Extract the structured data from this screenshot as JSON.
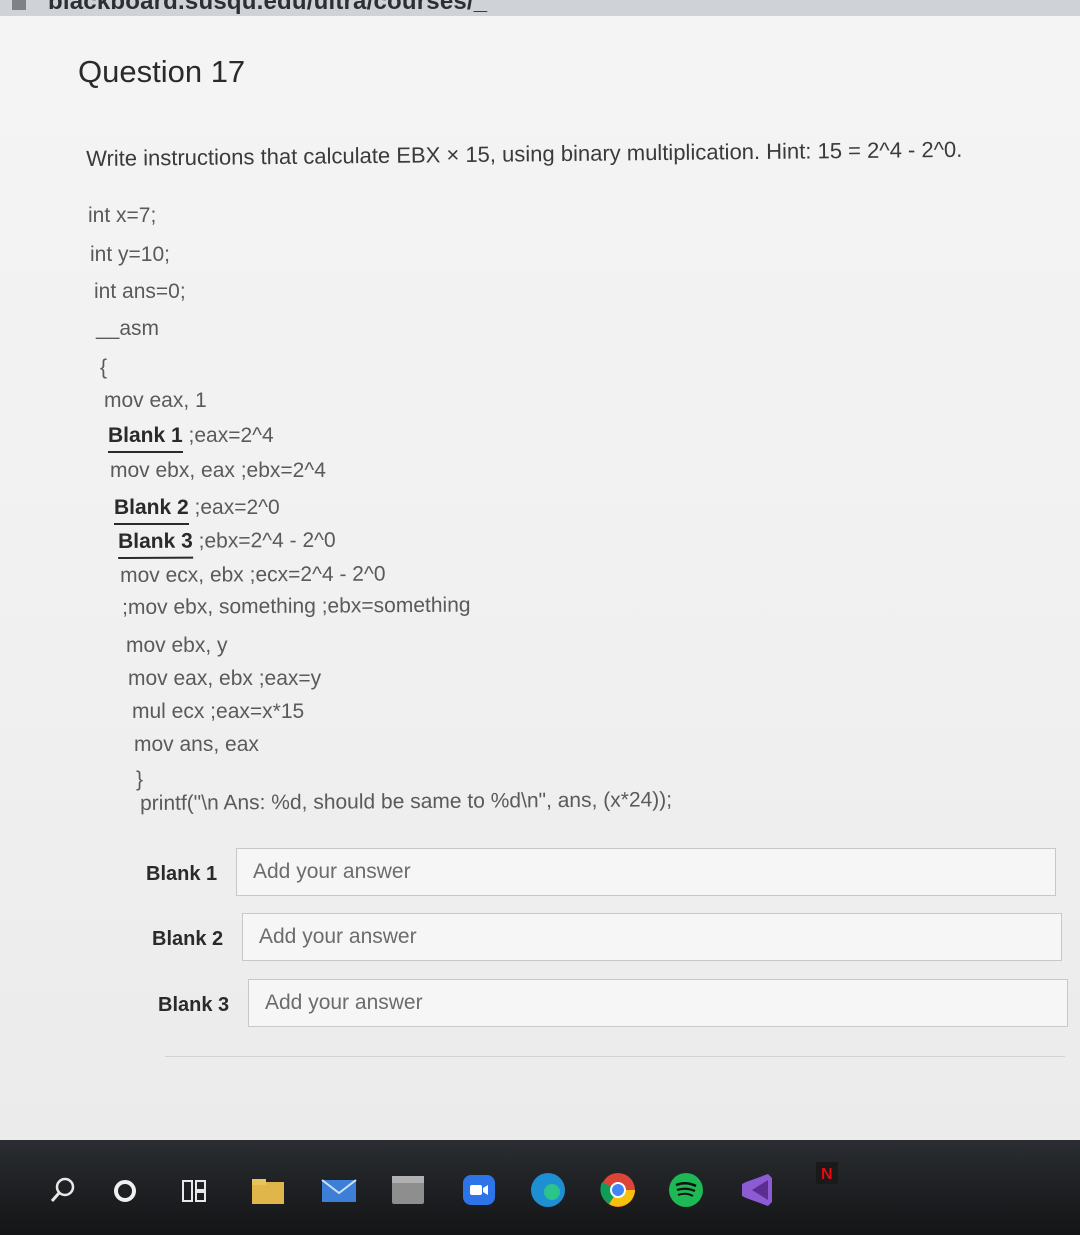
{
  "browser": {
    "url_fragment": "blackboard.susqu.edu/ultra/courses/_"
  },
  "question": {
    "title": "Question 17",
    "stem": "Write instructions that calculate EBX × 15, using binary multiplication. Hint: 15 = 2^4 - 2^0."
  },
  "code": [
    {
      "pre": "int x=7;",
      "blank": "",
      "post": ""
    },
    {
      "pre": "int y=10;",
      "blank": "",
      "post": ""
    },
    {
      "pre": "int ans=0;",
      "blank": "",
      "post": ""
    },
    {
      "pre": "__asm",
      "blank": "",
      "post": ""
    },
    {
      "pre": "{",
      "blank": "",
      "post": ""
    },
    {
      "pre": "mov eax, 1",
      "blank": "",
      "post": ""
    },
    {
      "pre": "",
      "blank": "Blank 1",
      "post": " ;eax=2^4"
    },
    {
      "pre": "mov ebx, eax ;ebx=2^4",
      "blank": "",
      "post": ""
    },
    {
      "pre": "",
      "blank": "Blank 2",
      "post": " ;eax=2^0"
    },
    {
      "pre": "",
      "blank": "Blank 3",
      "post": " ;ebx=2^4 - 2^0"
    },
    {
      "pre": "mov ecx, ebx ;ecx=2^4 - 2^0",
      "blank": "",
      "post": ""
    },
    {
      "pre": ";mov ebx, something ;ebx=something",
      "blank": "",
      "post": ""
    },
    {
      "pre": "mov ebx, y",
      "blank": "",
      "post": ""
    },
    {
      "pre": "mov eax, ebx ;eax=y",
      "blank": "",
      "post": ""
    },
    {
      "pre": "mul ecx ;eax=x*15",
      "blank": "",
      "post": ""
    },
    {
      "pre": "mov ans, eax",
      "blank": "",
      "post": ""
    },
    {
      "pre": "}",
      "blank": "",
      "post": ""
    },
    {
      "pre": "printf(\"\\n Ans: %d, should be same to %d\\n\", ans, (x*24));",
      "blank": "",
      "post": ""
    }
  ],
  "answers": [
    {
      "label": "Blank 1",
      "placeholder": "Add your answer",
      "value": ""
    },
    {
      "label": "Blank 2",
      "placeholder": "Add your answer",
      "value": ""
    },
    {
      "label": "Blank 3",
      "placeholder": "Add your answer",
      "value": ""
    }
  ],
  "taskbar": {
    "icons": [
      "search-icon",
      "cortana-icon",
      "task-view-icon",
      "file-explorer-icon",
      "mail-icon",
      "calendar-icon",
      "zoom-icon",
      "edge-icon",
      "chrome-icon",
      "spotify-icon",
      "visual-studio-icon",
      "netflix-icon"
    ]
  },
  "colors": {
    "page_bg": "#f2f2f2",
    "taskbar_bg": "#1e2024",
    "text": "#3a3a3a"
  }
}
